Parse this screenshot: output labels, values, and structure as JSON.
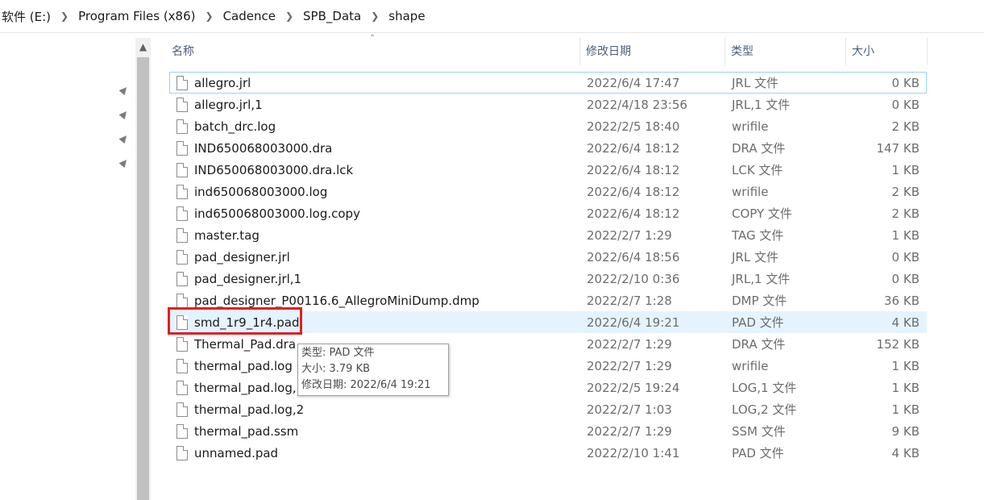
{
  "breadcrumb": [
    "软件 (E:)",
    "Program Files (x86)",
    "Cadence",
    "SPB_Data",
    "shape"
  ],
  "columns": {
    "name": "名称",
    "date": "修改日期",
    "type": "类型",
    "size": "大小"
  },
  "files": [
    {
      "name": "allegro.jrl",
      "date": "2022/6/4 17:47",
      "type": "JRL 文件",
      "size": "0 KB"
    },
    {
      "name": "allegro.jrl,1",
      "date": "2022/4/18 23:56",
      "type": "JRL,1 文件",
      "size": "0 KB"
    },
    {
      "name": "batch_drc.log",
      "date": "2022/2/5 18:40",
      "type": "wrifile",
      "size": "2 KB"
    },
    {
      "name": "IND650068003000.dra",
      "date": "2022/6/4 18:12",
      "type": "DRA 文件",
      "size": "147 KB"
    },
    {
      "name": "IND650068003000.dra.lck",
      "date": "2022/6/4 18:12",
      "type": "LCK 文件",
      "size": "1 KB"
    },
    {
      "name": "ind650068003000.log",
      "date": "2022/6/4 18:12",
      "type": "wrifile",
      "size": "2 KB"
    },
    {
      "name": "ind650068003000.log.copy",
      "date": "2022/6/4 18:12",
      "type": "COPY 文件",
      "size": "2 KB"
    },
    {
      "name": "master.tag",
      "date": "2022/2/7 1:29",
      "type": "TAG 文件",
      "size": "1 KB"
    },
    {
      "name": "pad_designer.jrl",
      "date": "2022/6/4 18:56",
      "type": "JRL 文件",
      "size": "0 KB"
    },
    {
      "name": "pad_designer.jrl,1",
      "date": "2022/2/10 0:36",
      "type": "JRL,1 文件",
      "size": "0 KB"
    },
    {
      "name": "pad_designer_P00116.6_AllegroMiniDump.dmp",
      "date": "2022/2/7 1:28",
      "type": "DMP 文件",
      "size": "36 KB"
    },
    {
      "name": "smd_1r9_1r4.pad",
      "date": "2022/6/4 19:21",
      "type": "PAD 文件",
      "size": "4 KB"
    },
    {
      "name": "Thermal_Pad.dra",
      "date": "2022/2/7 1:29",
      "type": "DRA 文件",
      "size": "152 KB"
    },
    {
      "name": "thermal_pad.log",
      "date": "2022/2/7 1:29",
      "type": "wrifile",
      "size": "1 KB"
    },
    {
      "name": "thermal_pad.log,1",
      "date": "2022/2/5 19:24",
      "type": "LOG,1 文件",
      "size": "1 KB"
    },
    {
      "name": "thermal_pad.log,2",
      "date": "2022/2/7 1:03",
      "type": "LOG,2 文件",
      "size": "1 KB"
    },
    {
      "name": "thermal_pad.ssm",
      "date": "2022/2/7 1:29",
      "type": "SSM 文件",
      "size": "9 KB"
    },
    {
      "name": "unnamed.pad",
      "date": "2022/2/10 1:41",
      "type": "PAD 文件",
      "size": "4 KB"
    }
  ],
  "tooltip": {
    "type_line": "类型: PAD 文件",
    "size_line": "大小: 3.79 KB",
    "date_line": "修改日期: 2022/6/4 19:21"
  },
  "colors": {
    "highlight": "#e02020",
    "selection": "#e5f3ff",
    "focus_border": "#99d1ff"
  },
  "icons": {
    "pin": "pin-icon",
    "file": "file-icon",
    "chevron": "chevron-right-icon",
    "scroll_up": "scroll-up-arrow-icon"
  }
}
